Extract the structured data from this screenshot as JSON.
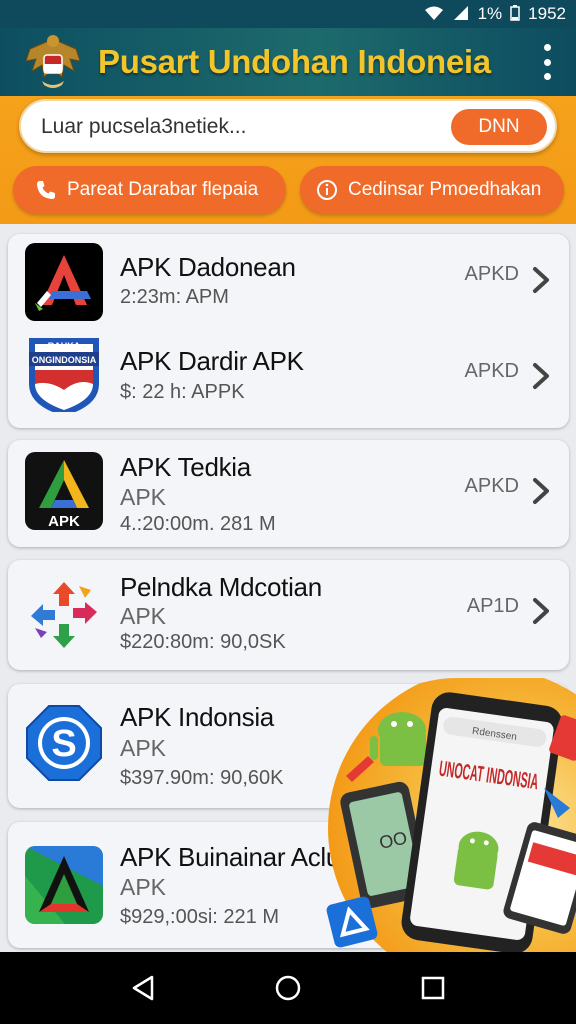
{
  "status_bar": {
    "battery": "1%",
    "time": "1952"
  },
  "app_bar": {
    "title": "Pusart Undohan Indoneia"
  },
  "search": {
    "value": "Luar pucsela3netiek...",
    "button_label": "DNN"
  },
  "quick_actions": [
    {
      "label": "Pareat Darabar flepaia",
      "icon": "phone-icon"
    },
    {
      "label": "Cedinsar Pmoedhakan",
      "icon": "info-circle-icon"
    }
  ],
  "apps": [
    {
      "name": "APK Dadonean",
      "type": "",
      "meta": "2:23m: APM",
      "tag": "APKD"
    },
    {
      "name": "APK Dardir APK",
      "type": "",
      "meta": "$: 22 h: APPK",
      "tag": "APKD"
    },
    {
      "name": "APK Tedkia",
      "type": "APK",
      "meta": "4.:20:00m. 281 M",
      "tag": "APKD"
    },
    {
      "name": "Pelndka Mdcotian",
      "type": "APK",
      "meta": "$220:80m: 90,0SK",
      "tag": "AP1D"
    },
    {
      "name": "APK Indonsia",
      "type": "APK",
      "meta": "$397.90m: 90,60K",
      "tag": ""
    },
    {
      "name": "APK Buinainar Aclun",
      "type": "APK",
      "meta": "$929,:00si: 221 M",
      "tag": ""
    }
  ],
  "icon_texts": {
    "app2_badge": "RAUKA",
    "app2_label": "ONGINDONSIA",
    "app3_label": "APK",
    "app5_letter": "S"
  },
  "promo": {
    "headline": "UNOCAT INDONSIA",
    "sub": "Rdenssen",
    "phone_label": "OO"
  },
  "colors": {
    "header": "#0e4a5c",
    "title": "#f2c62b",
    "orange": "#f39a17",
    "button": "#f06a2a"
  }
}
